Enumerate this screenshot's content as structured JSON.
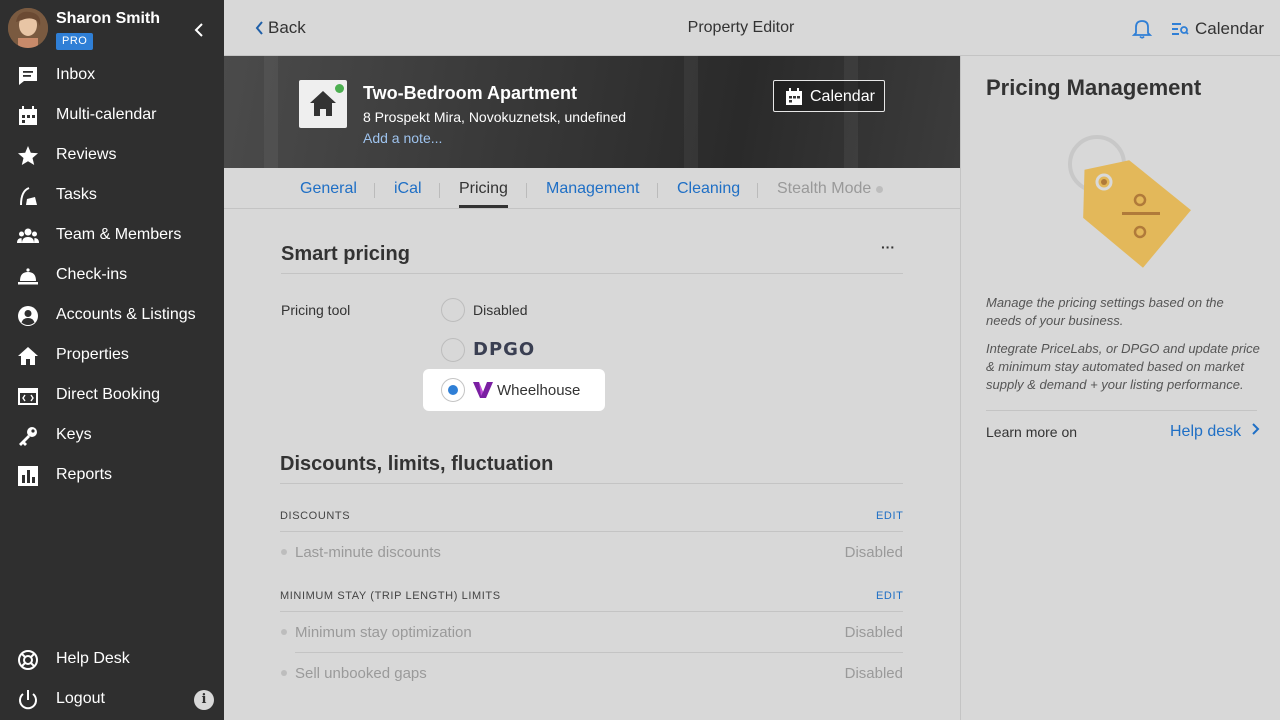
{
  "user": {
    "name": "Sharon Smith",
    "badge": "PRO"
  },
  "nav": {
    "items": [
      {
        "label": "Inbox",
        "icon": "inbox-icon"
      },
      {
        "label": "Multi-calendar",
        "icon": "calendar-icon"
      },
      {
        "label": "Reviews",
        "icon": "star-icon"
      },
      {
        "label": "Tasks",
        "icon": "broom-icon"
      },
      {
        "label": "Team & Members",
        "icon": "team-icon"
      },
      {
        "label": "Check-ins",
        "icon": "bell-desk-icon"
      },
      {
        "label": "Accounts & Listings",
        "icon": "account-icon"
      },
      {
        "label": "Properties",
        "icon": "home-icon"
      },
      {
        "label": "Direct Booking",
        "icon": "code-window-icon"
      },
      {
        "label": "Keys",
        "icon": "key-icon"
      },
      {
        "label": "Reports",
        "icon": "chart-icon"
      }
    ],
    "help_desk": "Help Desk",
    "logout": "Logout",
    "info": "i"
  },
  "topbar": {
    "back": "Back",
    "title": "Property Editor",
    "calendar": "Calendar"
  },
  "property": {
    "name": "Two-Bedroom Apartment",
    "address": "8 Prospekt Mira, Novokuznetsk, undefined",
    "add_note": "Add a note...",
    "calendar_button": "Calendar"
  },
  "tabs": [
    "General",
    "iCal",
    "Pricing",
    "Management",
    "Cleaning",
    "Stealth Mode"
  ],
  "active_tab": "Pricing",
  "smart_pricing": {
    "title": "Smart pricing",
    "more": "···",
    "field_label": "Pricing tool",
    "options": [
      {
        "label": "Disabled",
        "selected": false
      },
      {
        "label": "DPGO",
        "selected": false
      },
      {
        "label": "Wheelhouse",
        "selected": true
      }
    ]
  },
  "discounts": {
    "title": "Discounts, limits, fluctuation",
    "groups": [
      {
        "heading": "DISCOUNTS",
        "edit": "EDIT",
        "items": [
          {
            "label": "Last-minute discounts",
            "value": "Disabled"
          }
        ]
      },
      {
        "heading": "MINIMUM STAY (TRIP LENGTH) LIMITS",
        "edit": "EDIT",
        "items": [
          {
            "label": "Minimum stay optimization",
            "value": "Disabled"
          },
          {
            "label": "Sell unbooked gaps",
            "value": "Disabled"
          }
        ]
      }
    ]
  },
  "right_panel": {
    "title": "Pricing Management",
    "desc1": "Manage the pricing settings based on the needs of your business.",
    "desc2": "Integrate PriceLabs, or DPGO and update price & minimum stay automated based on market supply & demand + your listing performance.",
    "learn_more": "Learn more on",
    "help_desk": "Help desk"
  },
  "colors": {
    "accent": "#2f7fd6",
    "link": "#1f6fc5",
    "sidebar": "#2f2f2f",
    "background": "#d8d8d8",
    "tag": "#e3b85a"
  }
}
